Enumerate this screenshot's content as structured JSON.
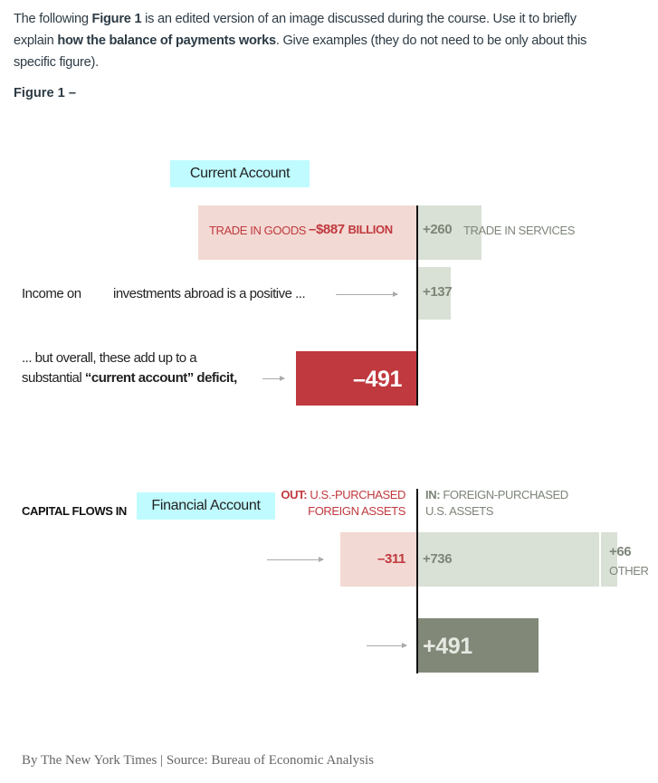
{
  "question": {
    "line1": {
      "a": "The following ",
      "b": "Figure 1",
      "c": " is an edited version of an image discussed during the course. Use it to briefly"
    },
    "line2": {
      "a": "explain ",
      "b": "how the balance of payments works",
      "c": ". Give examples (they do not need to be only about this"
    },
    "line3": "specific figure).",
    "figure_label": "Figure 1 –"
  },
  "chart_data": {
    "type": "bar",
    "orientation": "horizontal-diverging",
    "unit": "billion USD",
    "sections": [
      {
        "title": "Current Account",
        "bars": [
          {
            "category": "Trade in goods",
            "value": -887
          },
          {
            "category": "Trade in services",
            "value": 260
          },
          {
            "category": "Income on investments abroad",
            "value": 137
          },
          {
            "category": "Current account deficit",
            "value": -491
          }
        ]
      },
      {
        "title": "Financial Account",
        "bars": [
          {
            "category": "U.S.-purchased foreign assets",
            "value": -311
          },
          {
            "category": "Foreign-purchased U.S. assets",
            "value": 736
          },
          {
            "category": "Other",
            "value": 66
          },
          {
            "category": "Net capital flows in",
            "value": 491
          }
        ]
      }
    ],
    "colors": {
      "negative_light": "#f3d9d3",
      "positive_light": "#d9e0d5",
      "negative_strong": "#c0393e",
      "positive_strong": "#818878",
      "negative_text": "#c0393e",
      "positive_text": "#7d8579"
    }
  },
  "labels": {
    "current_account": "Current Account",
    "trade_goods": "TRADE IN GOODS",
    "trade_goods_value": "–$887",
    "billion": "BILLION",
    "services_value": "+260",
    "services": "TRADE IN SERVICES",
    "income_a": "Income on",
    "income_b": "investments abroad is a positive ...",
    "income_value": "+137",
    "overall_1": "... but overall, these add up to a",
    "overall_2a": "substantial ",
    "overall_2b": "“current account” deficit,",
    "ca_value": "–491",
    "capital_flows": "CAPITAL FLOWS IN",
    "financial_account": "Financial Account",
    "out_a": "OUT:",
    "out_b": " U.S.-PURCHASED",
    "out_c": "FOREIGN ASSETS",
    "in_a": "IN:",
    "in_b": " FOREIGN-PURCHASED",
    "in_c": "U.S. ASSETS",
    "out_value": "–311",
    "in_value": "+736",
    "other_value": "+66",
    "other": "OTHER",
    "fa_value": "+491"
  },
  "footer": "By The New York Times | Source: Bureau of Economic Analysis"
}
